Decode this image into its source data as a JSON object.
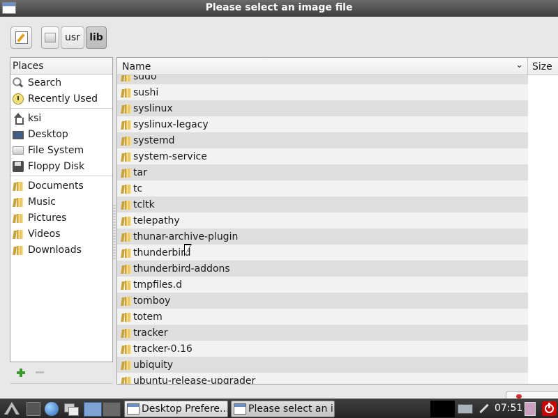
{
  "window": {
    "title": "Please select an image file"
  },
  "pathbar": {
    "segments": [
      "usr",
      "lib"
    ]
  },
  "places": {
    "header": "Places",
    "groups": [
      [
        {
          "label": "Search",
          "icon": "search-icon"
        },
        {
          "label": "Recently Used",
          "icon": "recent-icon"
        }
      ],
      [
        {
          "label": "ksi",
          "icon": "home-icon"
        },
        {
          "label": "Desktop",
          "icon": "desktop-icon"
        },
        {
          "label": "File System",
          "icon": "drive-icon"
        },
        {
          "label": "Floppy Disk",
          "icon": "floppy-icon"
        }
      ],
      [
        {
          "label": "Documents",
          "icon": "folder-icon"
        },
        {
          "label": "Music",
          "icon": "folder-icon"
        },
        {
          "label": "Pictures",
          "icon": "folder-icon"
        },
        {
          "label": "Videos",
          "icon": "folder-icon"
        },
        {
          "label": "Downloads",
          "icon": "folder-icon"
        }
      ]
    ]
  },
  "filelist": {
    "columns": {
      "name": "Name",
      "size": "Size"
    },
    "rows": [
      "sudo",
      "sushi",
      "syslinux",
      "syslinux-legacy",
      "systemd",
      "system-service",
      "tar",
      "tc",
      "tcltk",
      "telepathy",
      "thunar-archive-plugin",
      "thunderbird",
      "thunderbird-addons",
      "tmpfiles.d",
      "tomboy",
      "totem",
      "tracker",
      "tracker-0.16",
      "ubiquity",
      "ubuntu-release-upgrader"
    ]
  },
  "taskbar": {
    "tasks": [
      "Desktop Prefere...",
      "Please select an i..."
    ],
    "clock": "07:51"
  },
  "colors": {
    "titlebar": "#3d3d3d",
    "row_odd": "#dedede",
    "row_even": "#f2f2f2",
    "power": "#cc0000"
  }
}
